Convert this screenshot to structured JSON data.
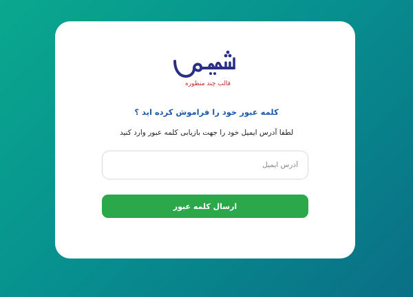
{
  "logo": {
    "name": "شیم",
    "tagline": "قالب چند منظوره",
    "colors": {
      "mark": "#2a2f86",
      "tagline": "#c0262a"
    }
  },
  "form": {
    "title": "کلمه عبور خود را فراموش کرده اید ؟",
    "description": "لطفا آدرس ایمیل خود را جهت بازیابی کلمه عبور وارد کنید",
    "email": {
      "value": "",
      "placeholder": "آدرس ایمیل"
    },
    "submit_label": "ارسال کلمه عبور"
  },
  "colors": {
    "background_start": "#0aa88e",
    "background_end": "#0a6f86",
    "title": "#1c5aa8",
    "button": "#2ba84a"
  }
}
